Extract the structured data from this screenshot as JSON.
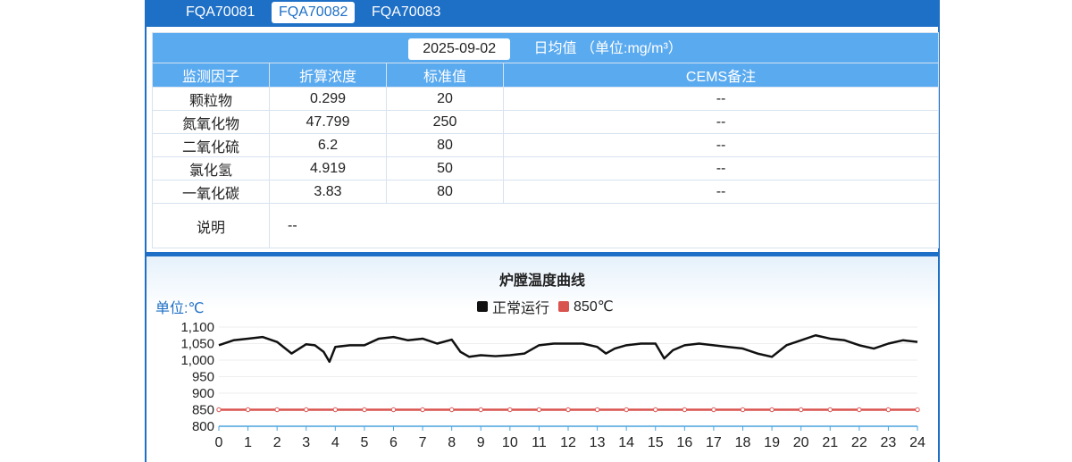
{
  "tabs": [
    {
      "label": "FQA70081",
      "active": false
    },
    {
      "label": "FQA70082",
      "active": true
    },
    {
      "label": "FQA70083",
      "active": false
    }
  ],
  "summary": {
    "date": "2025-09-02",
    "title": "日均值  （单位:mg/m³）",
    "columns": [
      "监测因子",
      "折算浓度",
      "标准值",
      "CEMS备注"
    ],
    "rows": [
      {
        "factor": "颗粒物",
        "value": "0.299",
        "standard": "20",
        "remark": "--"
      },
      {
        "factor": "氮氧化物",
        "value": "47.799",
        "standard": "250",
        "remark": "--"
      },
      {
        "factor": "二氧化硫",
        "value": "6.2",
        "standard": "80",
        "remark": "--"
      },
      {
        "factor": "氯化氢",
        "value": "4.919",
        "standard": "50",
        "remark": "--"
      },
      {
        "factor": "一氧化碳",
        "value": "3.83",
        "standard": "80",
        "remark": "--"
      }
    ],
    "note_label": "说明",
    "note_value": "--"
  },
  "chart_title": "炉膛温度曲线",
  "unit_label": "单位:℃",
  "chart_data": {
    "type": "line",
    "title": "炉膛温度曲线",
    "ylabel": "单位:℃",
    "xlim": [
      0,
      24
    ],
    "ylim": [
      800,
      1100
    ],
    "x_ticks": [
      "0",
      "1",
      "2",
      "3",
      "4",
      "5",
      "6",
      "7",
      "8",
      "9",
      "10",
      "11",
      "12",
      "13",
      "14",
      "15",
      "16",
      "17",
      "18",
      "19",
      "20",
      "21",
      "22",
      "23",
      "24"
    ],
    "y_ticks": [
      "800",
      "850",
      "900",
      "950",
      "1,000",
      "1,050",
      "1,100"
    ],
    "y_tick_values": [
      800,
      850,
      900,
      950,
      1000,
      1050,
      1100
    ],
    "legend_position": "top-center",
    "series": [
      {
        "name": "正常运行",
        "color": "#111111",
        "x": [
          0,
          0.5,
          1,
          1.5,
          2,
          2.5,
          3,
          3.3,
          3.6,
          3.8,
          4,
          4.5,
          5,
          5.5,
          6,
          6.5,
          7,
          7.5,
          8,
          8.3,
          8.6,
          9,
          9.5,
          10,
          10.5,
          11,
          11.5,
          12,
          12.5,
          13,
          13.3,
          13.6,
          14,
          14.5,
          15,
          15.3,
          15.6,
          16,
          16.5,
          17,
          17.5,
          18,
          18.5,
          19,
          19.5,
          20,
          20.5,
          21,
          21.5,
          22,
          22.5,
          23,
          23.5,
          24
        ],
        "y": [
          1045,
          1060,
          1065,
          1070,
          1055,
          1020,
          1048,
          1045,
          1025,
          995,
          1040,
          1045,
          1045,
          1065,
          1070,
          1060,
          1065,
          1050,
          1062,
          1025,
          1010,
          1015,
          1012,
          1015,
          1020,
          1045,
          1050,
          1050,
          1050,
          1040,
          1020,
          1035,
          1045,
          1050,
          1050,
          1005,
          1030,
          1045,
          1050,
          1045,
          1040,
          1035,
          1020,
          1010,
          1045,
          1060,
          1075,
          1065,
          1060,
          1045,
          1035,
          1050,
          1060,
          1055
        ]
      },
      {
        "name": "850℃",
        "color": "#d9534f",
        "x": [
          0,
          1,
          2,
          3,
          4,
          5,
          6,
          7,
          8,
          9,
          10,
          11,
          12,
          13,
          14,
          15,
          16,
          17,
          18,
          19,
          20,
          21,
          22,
          23,
          24
        ],
        "y": [
          850,
          850,
          850,
          850,
          850,
          850,
          850,
          850,
          850,
          850,
          850,
          850,
          850,
          850,
          850,
          850,
          850,
          850,
          850,
          850,
          850,
          850,
          850,
          850,
          850
        ]
      }
    ]
  }
}
